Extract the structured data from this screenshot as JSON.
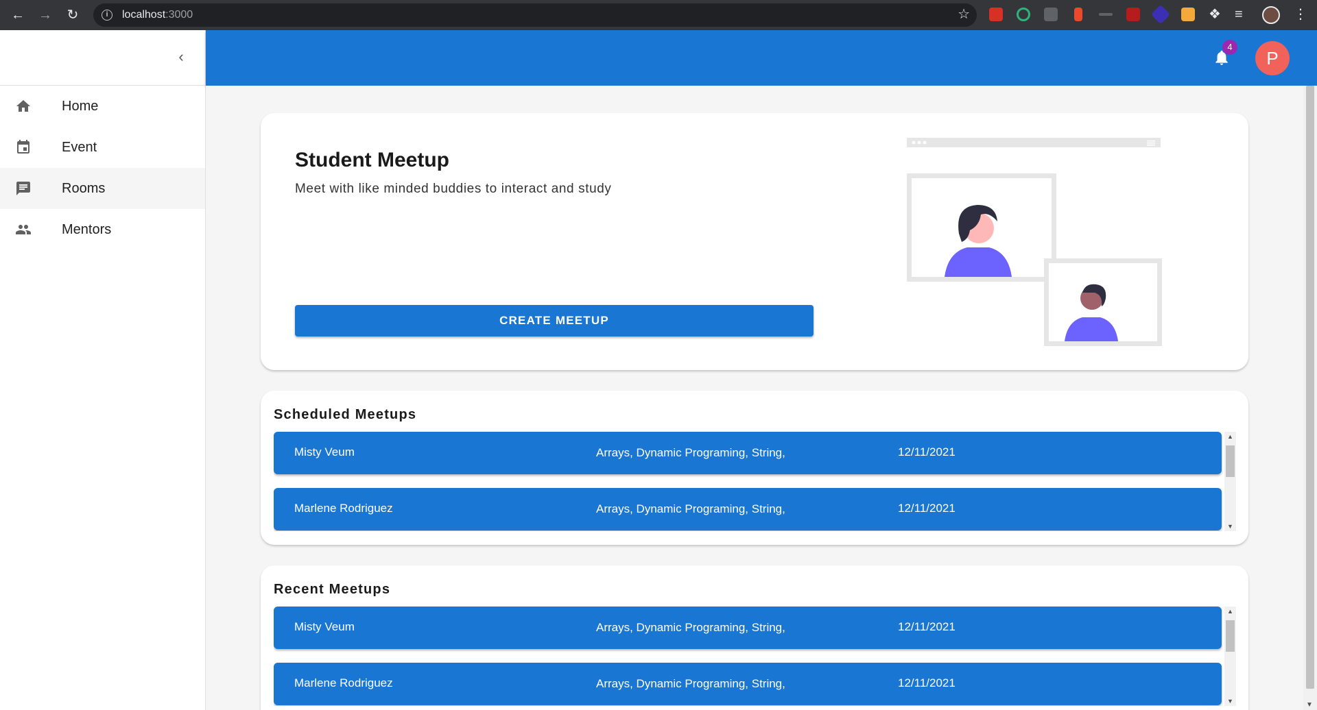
{
  "browser": {
    "url_host": "localhost",
    "url_port": ":3000"
  },
  "sidebar": {
    "items": [
      {
        "label": "Home",
        "icon": "home-icon"
      },
      {
        "label": "Event",
        "icon": "calendar-icon"
      },
      {
        "label": "Rooms",
        "icon": "chat-icon"
      },
      {
        "label": "Mentors",
        "icon": "people-icon"
      }
    ]
  },
  "appbar": {
    "notification_count": "4",
    "avatar_initial": "P",
    "color": "#1976d2"
  },
  "hero": {
    "title": "Student Meetup",
    "subtitle": "Meet with like minded buddies to interact and study",
    "button_label": "CREATE MEETUP"
  },
  "scheduled": {
    "title": "Scheduled Meetups",
    "rows": [
      {
        "name": "Misty Veum",
        "topics": "Arrays, Dynamic Programing, String,",
        "date": "12/11/2021"
      },
      {
        "name": "Marlene Rodriguez",
        "topics": "Arrays, Dynamic Programing, String,",
        "date": "12/11/2021"
      }
    ]
  },
  "recent": {
    "title": "Recent Meetups",
    "rows": [
      {
        "name": "Misty Veum",
        "topics": "Arrays, Dynamic Programing, String,",
        "date": "12/11/2021"
      },
      {
        "name": "Marlene Rodriguez",
        "topics": "Arrays, Dynamic Programing, String,",
        "date": "12/11/2021"
      }
    ]
  }
}
